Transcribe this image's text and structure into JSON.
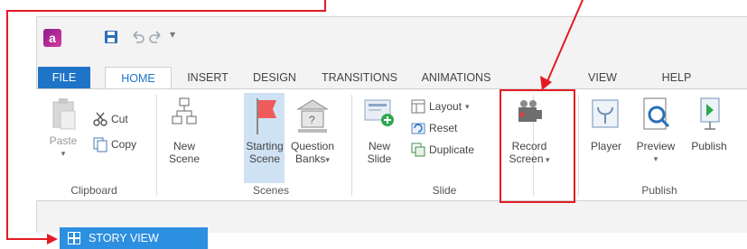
{
  "app": {
    "logo_letter": "a"
  },
  "tabs": [
    {
      "label": "FILE"
    },
    {
      "label": "HOME"
    },
    {
      "label": "INSERT"
    },
    {
      "label": "DESIGN"
    },
    {
      "label": "TRANSITIONS"
    },
    {
      "label": "ANIMATIONS"
    },
    {
      "label": "VIEW"
    },
    {
      "label": "HELP"
    }
  ],
  "clipboard": {
    "paste": "Paste",
    "cut": "Cut",
    "copy": "Copy",
    "group": "Clipboard"
  },
  "scenes": {
    "new_scene_1": "New",
    "new_scene_2": "Scene",
    "starting_scene_1": "Starting",
    "starting_scene_2": "Scene",
    "question_banks_1": "Question",
    "question_banks_2": "Banks",
    "group": "Scenes"
  },
  "slide": {
    "new_slide_1": "New",
    "new_slide_2": "Slide",
    "layout": "Layout",
    "reset": "Reset",
    "duplicate": "Duplicate",
    "group": "Slide"
  },
  "record": {
    "record_1": "Record",
    "record_2": "Screen"
  },
  "publish": {
    "player": "Player",
    "preview": "Preview",
    "publish": "Publish",
    "group": "Publish"
  },
  "story_view": {
    "label": "STORY VIEW"
  },
  "colors": {
    "accent": "#1f74c7",
    "highlight": "#e21b23",
    "story_view_bg": "#2d8fe0",
    "selected_bg": "#cfe2f3"
  }
}
